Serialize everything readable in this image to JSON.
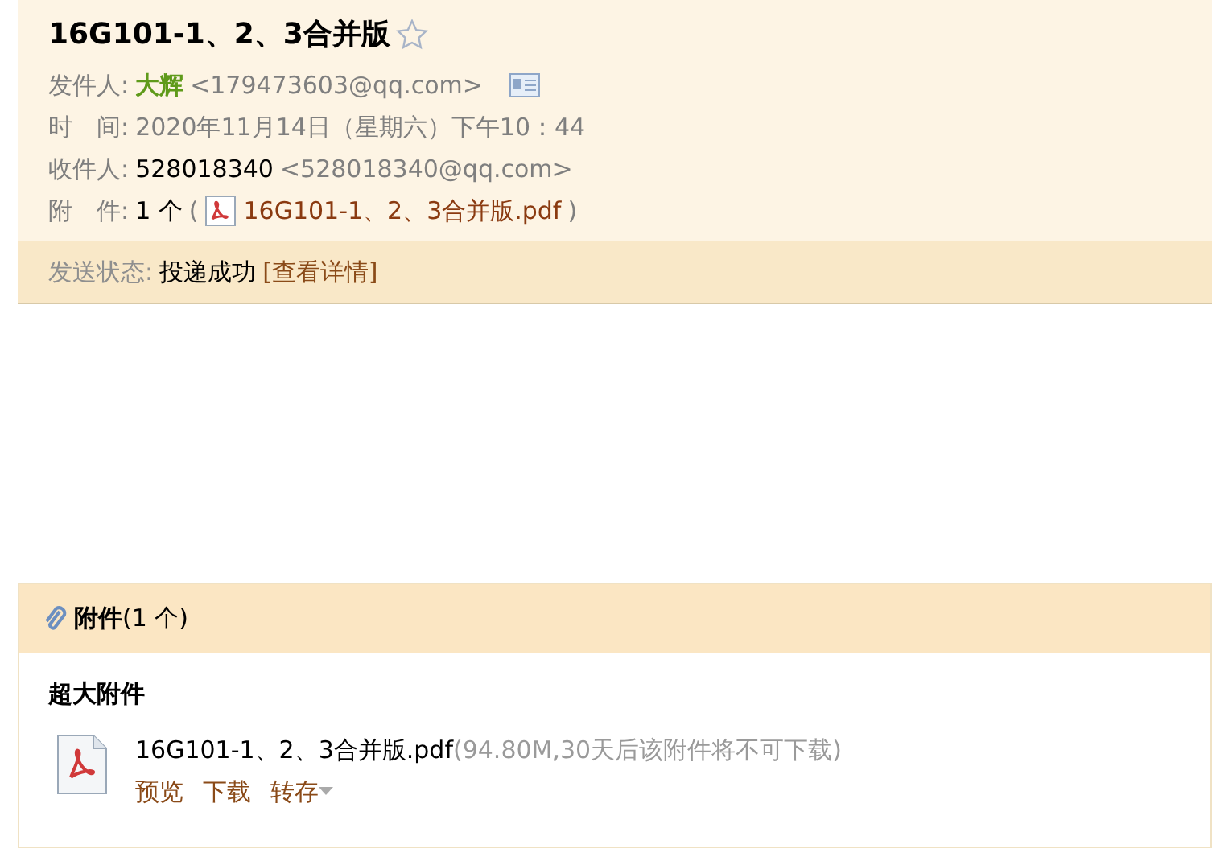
{
  "subject": "16G101-1、2、3合并版",
  "starred": false,
  "sender": {
    "label": "发件人:",
    "name": "大辉",
    "address": "<179473603@qq.com>"
  },
  "time": {
    "label": "时　间:",
    "value": "2020年11月14日（星期六）下午10：44"
  },
  "recipient": {
    "label": "收件人:",
    "name": "528018340",
    "address": "<528018340@qq.com>"
  },
  "attachment_line": {
    "label": "附　件:",
    "count": "1 个",
    "open": "(",
    "file": "16G101-1、2、3合并版.pdf",
    "close": ")"
  },
  "send_status": {
    "label": "发送状态:",
    "value": "投递成功",
    "details": "[查看详情]"
  },
  "attachments": {
    "title": "附件",
    "count": "(1 个)",
    "group": "超大附件",
    "files": [
      {
        "name": "16G101-1、2、3合并版.pdf",
        "info": "(94.80M,30天后该附件将不可下载)",
        "actions": [
          "预览",
          "下载",
          "转存"
        ]
      }
    ]
  }
}
